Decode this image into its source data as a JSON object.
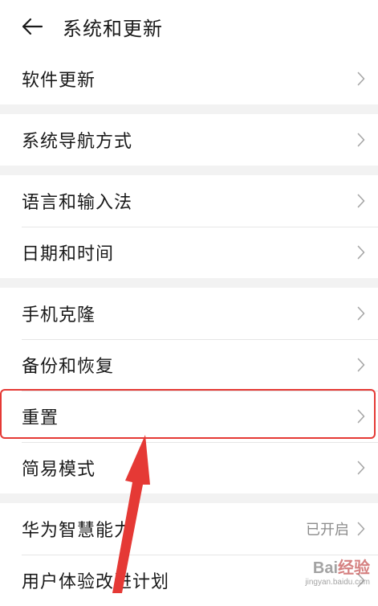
{
  "header": {
    "title": "系统和更新"
  },
  "groups": [
    {
      "items": [
        {
          "label": "软件更新"
        }
      ]
    },
    {
      "items": [
        {
          "label": "系统导航方式"
        }
      ]
    },
    {
      "items": [
        {
          "label": "语言和输入法"
        },
        {
          "label": "日期和时间"
        }
      ]
    },
    {
      "items": [
        {
          "label": "手机克隆"
        },
        {
          "label": "备份和恢复"
        },
        {
          "label": "重置"
        },
        {
          "label": "简易模式"
        }
      ]
    },
    {
      "items": [
        {
          "label": "华为智慧能力",
          "status": "已开启"
        },
        {
          "label": "用户体验改进计划"
        }
      ]
    }
  ],
  "watermark": {
    "text_a": "Bai",
    "text_b": "经验",
    "sub": "jingyan.baidu.com"
  },
  "colors": {
    "highlight": "#e53935",
    "background": "#f2f2f2"
  }
}
